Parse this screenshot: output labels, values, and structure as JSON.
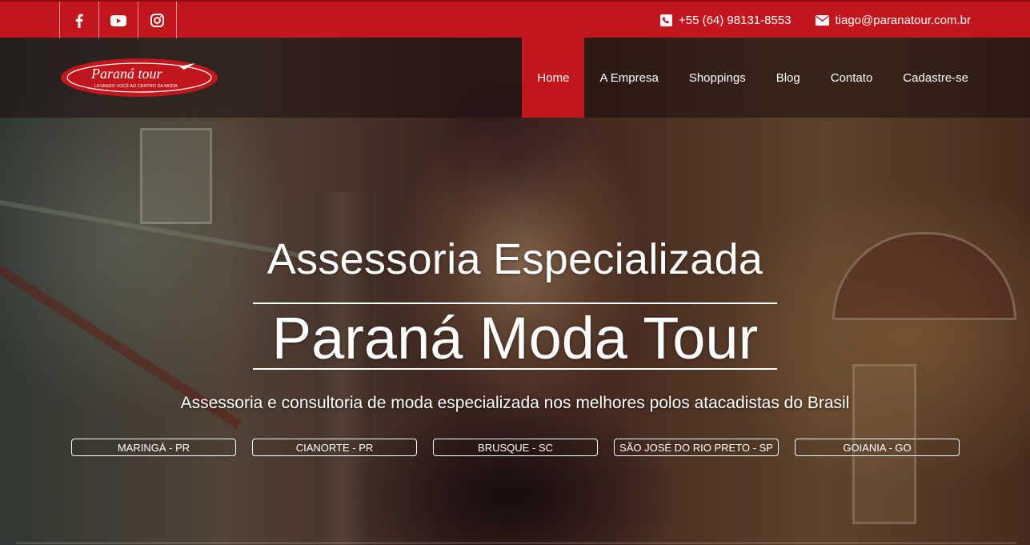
{
  "topbar": {
    "social": [
      {
        "icon": "facebook-icon",
        "glyph": "f"
      },
      {
        "icon": "youtube-icon",
        "glyph": "▶"
      },
      {
        "icon": "instagram-icon",
        "glyph": "◎"
      }
    ],
    "phone": "+55 (64) 98131-8553",
    "email": "tiago@paranatour.com.br"
  },
  "logo": {
    "name": "Paraná tour",
    "tagline": "LEVANDO VOCÊ AO CENTRO DA MODA"
  },
  "nav": {
    "items": [
      "Home",
      "A Empresa",
      "Shoppings",
      "Blog",
      "Contato",
      "Cadastre-se"
    ],
    "active": "Home"
  },
  "hero": {
    "title1": "Assessoria Especializada",
    "title2": "Paraná Moda Tour",
    "subtitle": "Assessoria e consultoria de moda especializada nos melhores polos atacadistas do Brasil",
    "cities": [
      "MARINGÁ - PR",
      "CIANORTE - PR",
      "BRUSQUE - SC",
      "SÃO JOSÉ DO RIO PRETO - SP",
      "GOIANIA - GO"
    ]
  },
  "colors": {
    "brand_red": "#c3161c",
    "text_white": "#ffffff"
  }
}
